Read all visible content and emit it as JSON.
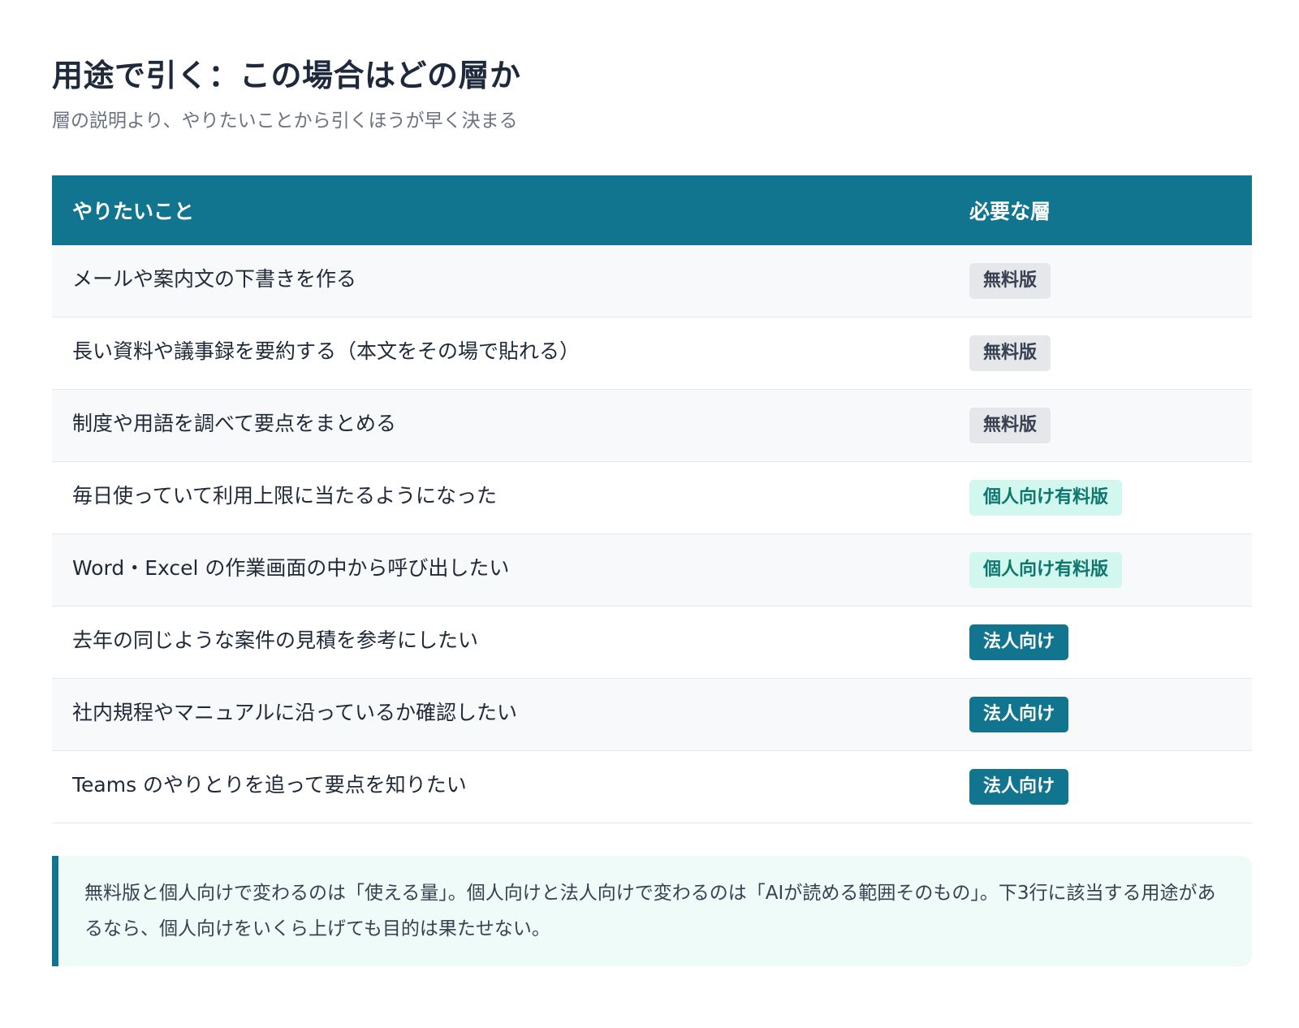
{
  "title": "用途で引く：この場合はどの層か",
  "subtitle": "層の説明より、やりたいことから引くほうが早く決まる",
  "table": {
    "headers": {
      "task": "やりたいこと",
      "tier": "必要な層"
    },
    "rows": [
      {
        "task": "メールや案内文の下書きを作る",
        "tier": "無料版",
        "tier_type": "free"
      },
      {
        "task": "長い資料や議事録を要約する（本文をその場で貼れる）",
        "tier": "無料版",
        "tier_type": "free"
      },
      {
        "task": "制度や用語を調べて要点をまとめる",
        "tier": "無料版",
        "tier_type": "free"
      },
      {
        "task": "毎日使っていて利用上限に当たるようになった",
        "tier": "個人向け有料版",
        "tier_type": "personal"
      },
      {
        "task": "Word・Excel の作業画面の中から呼び出したい",
        "tier": "個人向け有料版",
        "tier_type": "personal"
      },
      {
        "task": "去年の同じような案件の見積を参考にしたい",
        "tier": "法人向け",
        "tier_type": "business"
      },
      {
        "task": "社内規程やマニュアルに沿っているか確認したい",
        "tier": "法人向け",
        "tier_type": "business"
      },
      {
        "task": "Teams のやりとりを追って要点を知りたい",
        "tier": "法人向け",
        "tier_type": "business"
      }
    ]
  },
  "note": "無料版と個人向けで変わるのは「使える量」。個人向けと法人向けで変わるのは「AIが読める範囲そのもの」。下3行に該当する用途があるなら、個人向けをいくら上げても目的は果たせない。",
  "colors": {
    "accent": "#11758f",
    "free_badge_bg": "#e5e7eb",
    "personal_badge_bg": "#d1f7ee",
    "personal_badge_text": "#0f766e",
    "note_bg": "#effbf9"
  }
}
